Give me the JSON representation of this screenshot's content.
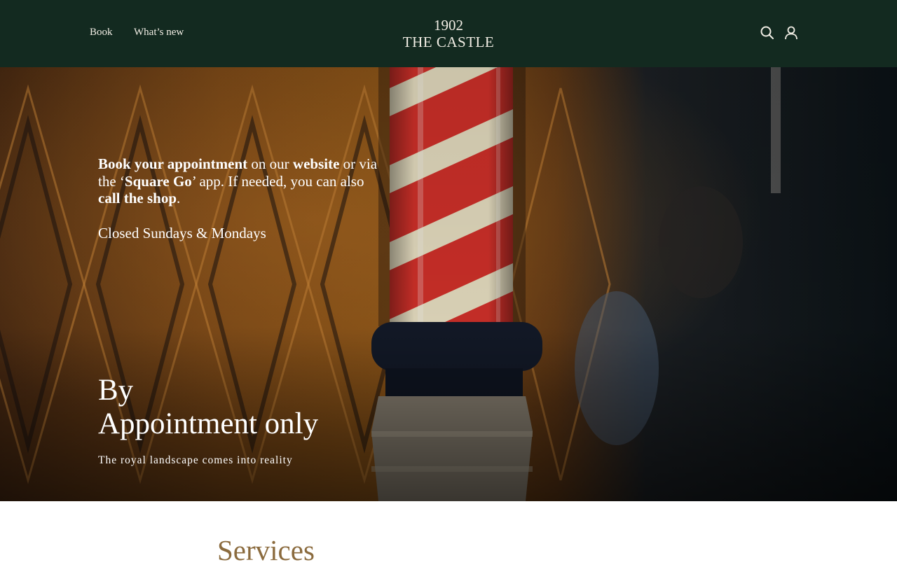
{
  "header": {
    "nav": [
      {
        "label": "Book"
      },
      {
        "label": "What’s new"
      }
    ],
    "logo": {
      "line1": "1902",
      "line2": "THE CASTLE"
    },
    "icons": [
      "search-icon",
      "account-icon"
    ],
    "background_color": "#132a20"
  },
  "hero": {
    "intro": [
      {
        "text": "Book your appointment",
        "bold": true
      },
      {
        "text": " on our ",
        "bold": false
      },
      {
        "text": "website",
        "bold": true
      },
      {
        "text": " or via the ‘",
        "bold": false
      },
      {
        "text": "Square Go",
        "bold": true
      },
      {
        "text": "’ app. If needed, you can also ",
        "bold": false
      },
      {
        "text": "call the shop",
        "bold": true
      },
      {
        "text": ".",
        "bold": false
      }
    ],
    "hours": "Closed Sundays & Mondays",
    "title_line1": "By",
    "title_line2": "Appointment only",
    "subtitle": "The royal landscape comes into reality"
  },
  "services": {
    "heading": "Services",
    "color": "#8b6b3e"
  }
}
